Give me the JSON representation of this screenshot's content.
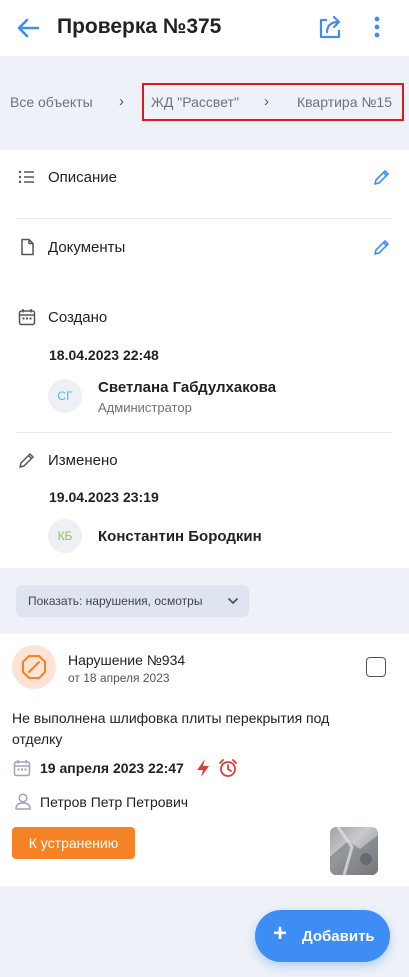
{
  "header": {
    "title": "Проверка №375"
  },
  "breadcrumbs": [
    "Все объекты",
    "ЖД \"Рассвет\"",
    "Квартира №15"
  ],
  "info": {
    "description_label": "Описание",
    "documents_label": "Документы",
    "created": {
      "label": "Создано",
      "date": "18.04.2023 22:48",
      "avatar_initials": "СГ",
      "person": "Светлана Габдулхакова",
      "role": "Администратор"
    },
    "modified": {
      "label": "Изменено",
      "date": "19.04.2023 23:19",
      "avatar_initials": "КБ",
      "person": "Константин Бородкин"
    }
  },
  "filter": {
    "label": "Показать: нарушения, осмотры"
  },
  "violation": {
    "title": "Нарушение №934",
    "subtitle": "от 18 апреля 2023",
    "description": "Не выполнена шлифовка плиты перекрытия под отделку",
    "due": "19 апреля 2023 22:47",
    "assignee": "Петров Петр Петрович",
    "status": "К устранению"
  },
  "fab": {
    "label": "Добавить"
  },
  "colors": {
    "accent": "#3d8df5",
    "status_orange": "#f58225",
    "urgent_red": "#e53935",
    "highlight_border": "#e01919"
  },
  "icons": {
    "back": "arrow-left-icon",
    "share": "share-icon",
    "more": "more-vertical-icon",
    "description": "list-icon",
    "documents": "file-icon",
    "created": "calendar-icon",
    "modified": "pencil-icon",
    "edit": "pencil-icon",
    "violation": "prohibited-icon",
    "urgent": "lightning-icon",
    "reminder": "alarm-icon",
    "assignee": "user-icon",
    "fab": "plus-icon"
  }
}
